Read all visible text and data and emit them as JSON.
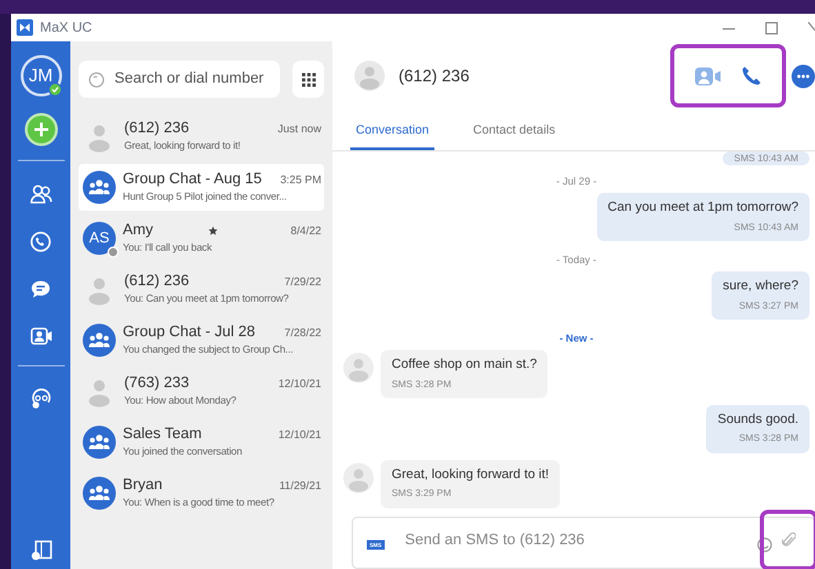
{
  "window": {
    "title": "MaX UC"
  },
  "user": {
    "initials": "JM",
    "online": true
  },
  "search": {
    "placeholder": "Search or dial number"
  },
  "conversations": [
    {
      "name": "(612) 236",
      "preview": "Great, looking forward to it!",
      "time": "Just now",
      "kind": "person",
      "selected": false,
      "starred": false
    },
    {
      "name": "Group Chat - Aug 15",
      "preview": "Hunt Group 5 Pilot joined the conver...",
      "time": "3:25 PM",
      "kind": "group",
      "selected": true,
      "starred": false
    },
    {
      "name": "Amy",
      "preview": "You: I'll call you back",
      "time": "8/4/22",
      "kind": "initials",
      "initials": "AS",
      "selected": false,
      "starred": true
    },
    {
      "name": "(612) 236",
      "preview": "You: Can you meet at 1pm tomorrow?",
      "time": "7/29/22",
      "kind": "person",
      "selected": false,
      "starred": false
    },
    {
      "name": "Group Chat - Jul 28",
      "preview": "You changed the subject to Group Ch...",
      "time": "7/28/22",
      "kind": "group",
      "selected": false,
      "starred": false
    },
    {
      "name": "(763) 233",
      "preview": "You: How about Monday?",
      "time": "12/10/21",
      "kind": "person",
      "selected": false,
      "starred": false
    },
    {
      "name": "Sales Team",
      "preview": "You joined the conversation",
      "time": "12/10/21",
      "kind": "group",
      "selected": false,
      "starred": false
    },
    {
      "name": "Bryan",
      "preview": "You: When is a good time to meet?",
      "time": "11/29/21",
      "kind": "group",
      "selected": false,
      "starred": false
    }
  ],
  "chat": {
    "contact": "(612) 236",
    "tabs": [
      {
        "label": "Conversation",
        "selected": true
      },
      {
        "label": "Contact details",
        "selected": false
      }
    ],
    "messages": [
      {
        "kind": "outgoing",
        "meta": "SMS 10:43 AM"
      },
      {
        "kind": "divider",
        "text": "- Jul 29 -",
        "highlight": false
      },
      {
        "kind": "outgoing",
        "text": "Can you meet at 1pm tomorrow?",
        "meta": "SMS 10:43 AM"
      },
      {
        "kind": "divider",
        "text": "- Today -",
        "highlight": false
      },
      {
        "kind": "outgoing",
        "text": "sure, where?",
        "meta": "SMS 3:27 PM"
      },
      {
        "kind": "divider",
        "text": "- New -",
        "highlight": true
      },
      {
        "kind": "incoming",
        "text": "Coffee shop on main st.?",
        "meta": "SMS 3:28 PM"
      },
      {
        "kind": "outgoing",
        "text": "Sounds good.",
        "meta": "SMS 3:28 PM"
      },
      {
        "kind": "incoming",
        "text": "Great, looking forward to it!",
        "meta": "SMS 3:29 PM"
      }
    ],
    "composer": {
      "badge": "SMS",
      "placeholder": "Send an SMS to (612) 236"
    }
  }
}
